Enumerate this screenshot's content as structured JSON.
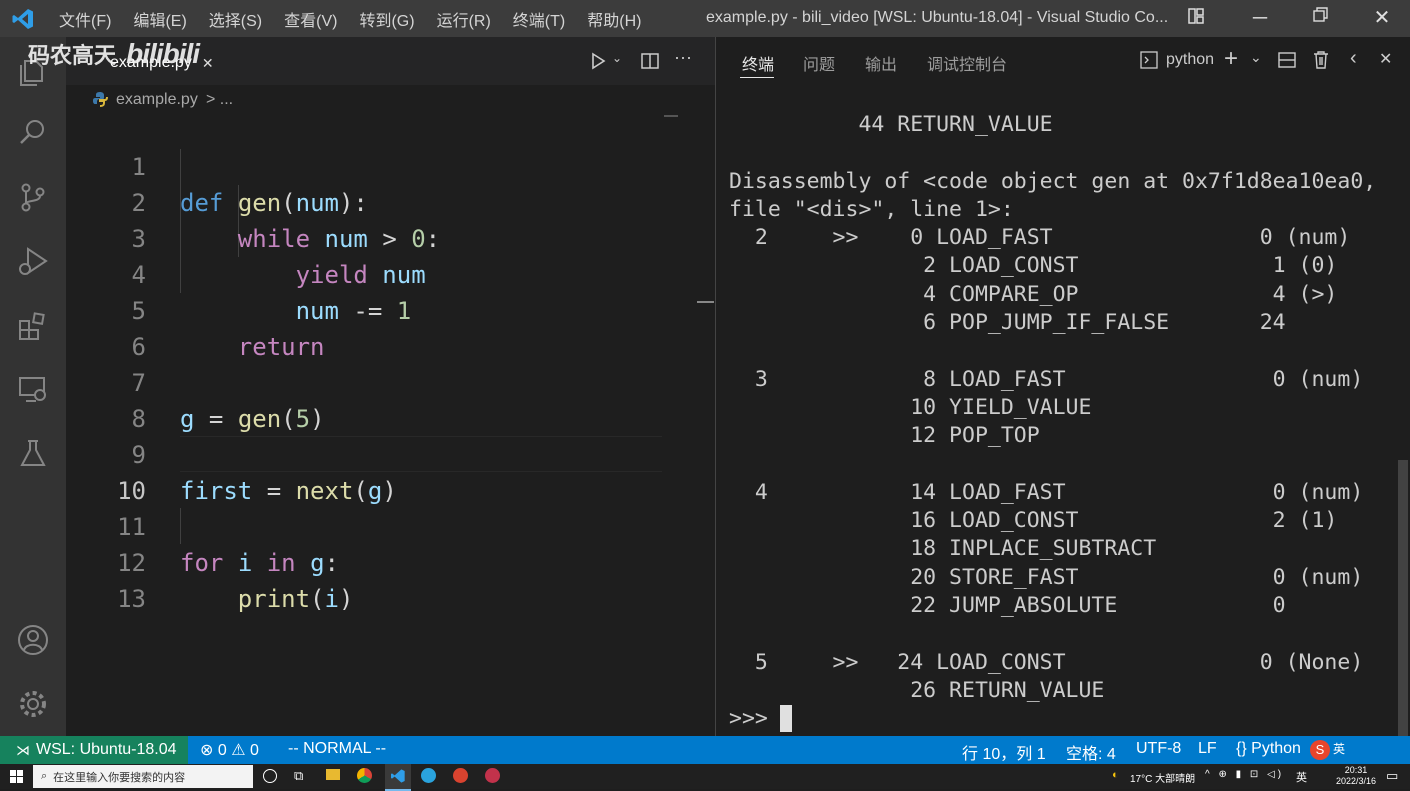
{
  "menu": [
    "文件(F)",
    "编辑(E)",
    "选择(S)",
    "查看(V)",
    "转到(G)",
    "运行(R)",
    "终端(T)",
    "帮助(H)"
  ],
  "window_title": "example.py - bili_video [WSL: Ubuntu-18.04] - Visual Studio Co...",
  "watermark": "码农高天",
  "watermark_logo": "bilibili",
  "editor": {
    "tab_label": "example.py",
    "breadcrumb_file": "example.py",
    "breadcrumb_rest": "> ...",
    "current_line": "10",
    "line_numbers": [
      "1",
      "2",
      "3",
      "4",
      "5",
      "6",
      "7",
      "8",
      "9",
      "10",
      "11",
      "12",
      "13"
    ]
  },
  "panel": {
    "tabs": [
      "终端",
      "问题",
      "输出",
      "调试控制台"
    ],
    "terminal_name": "python"
  },
  "terminal_lines": [
    "          44 RETURN_VALUE",
    "",
    "Disassembly of <code object gen at 0x7f1d8ea10ea0,",
    "file \"<dis>\", line 1>:",
    "  2     >>    0 LOAD_FAST                0 (num)",
    "               2 LOAD_CONST               1 (0)",
    "               4 COMPARE_OP               4 (>)",
    "               6 POP_JUMP_IF_FALSE       24",
    "",
    "  3            8 LOAD_FAST                0 (num)",
    "              10 YIELD_VALUE",
    "              12 POP_TOP",
    "",
    "  4           14 LOAD_FAST                0 (num)",
    "              16 LOAD_CONST               2 (1)",
    "              18 INPLACE_SUBTRACT",
    "              20 STORE_FAST               0 (num)",
    "              22 JUMP_ABSOLUTE            0",
    "",
    "  5     >>   24 LOAD_CONST               0 (None)",
    "              26 RETURN_VALUE",
    ">>> "
  ],
  "statusbar": {
    "remote": "WSL: Ubuntu-18.04",
    "errors": "0",
    "warnings": "0",
    "mode": "-- NORMAL --",
    "position": "行 10，列 1",
    "spaces": "空格: 4",
    "encoding": "UTF-8",
    "eol": "LF",
    "language": "Python"
  },
  "taskbar": {
    "search_placeholder": "在这里输入你要搜索的内容",
    "weather": "17°C 大部晴朗",
    "ime": "英",
    "time": "20:31",
    "date": "2022/3/16"
  },
  "colors": {
    "statusbar": "#007acc",
    "remote": "#16825d",
    "titlebar": "#3c3c3c",
    "activitybar": "#333333",
    "editor_bg": "#1e1e1e"
  }
}
